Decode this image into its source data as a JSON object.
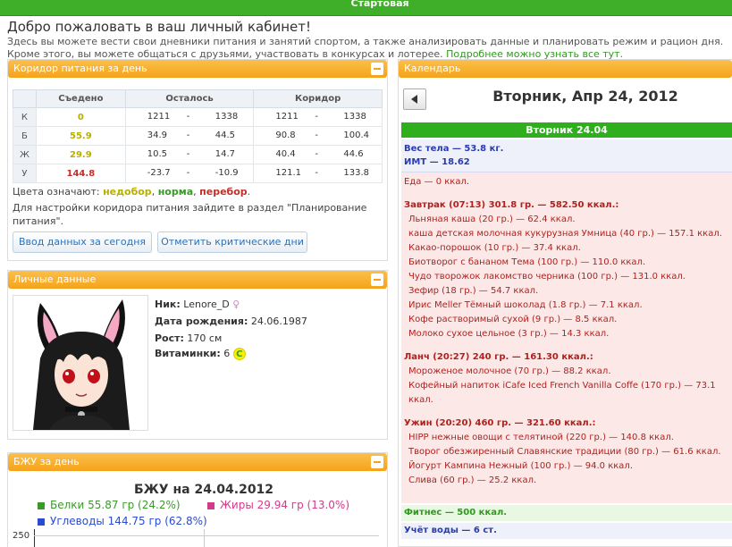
{
  "topbar": {
    "tab": "Стартовая"
  },
  "welcome": "Добро пожаловать в ваш личный кабинет!",
  "desc": {
    "line1": "Здесь вы можете вести свои дневники питания и занятий спортом, а также анализировать данные и планировать режим и рацион дня.",
    "line2": "Кроме этого, вы можете общаться с друзьями, участвовать в конкурсах и лотерее.",
    "more_link": "Подробнее можно узнать все тут."
  },
  "corridor": {
    "title": "Коридор питания за день",
    "headers": [
      "Съедено",
      "Осталось",
      "Коридор"
    ],
    "rows": [
      {
        "label": "К",
        "eaten": "0",
        "rem_min": "1211",
        "rem_max": "1338",
        "cor_min": "1211",
        "cor_max": "1338",
        "status": "under"
      },
      {
        "label": "Б",
        "eaten": "55.9",
        "rem_min": "34.9",
        "rem_max": "44.5",
        "cor_min": "90.8",
        "cor_max": "100.4",
        "status": "under"
      },
      {
        "label": "Ж",
        "eaten": "29.9",
        "rem_min": "10.5",
        "rem_max": "14.7",
        "cor_min": "40.4",
        "cor_max": "44.6",
        "status": "under"
      },
      {
        "label": "У",
        "eaten": "144.8",
        "rem_min": "-23.7",
        "rem_max": "-10.9",
        "cor_min": "121.1",
        "cor_max": "133.8",
        "status": "over"
      }
    ],
    "dash": "-",
    "legend_prefix": "Цвета означают:",
    "legend_under": "недобор",
    "legend_norm": "норма",
    "legend_over": "перебор",
    "note": "Для настройки коридора питания зайдите в раздел \"Планирование питания\".",
    "btn_today": "Ввод данных за сегодня",
    "btn_critical": "Отметить критические дни",
    "colors": {
      "under": "#b8b000",
      "norm": "#3a9a28",
      "over": "#c0302a"
    }
  },
  "personal": {
    "title": "Личные данные",
    "nick_label": "Ник:",
    "nick": "Lenore_D",
    "birth_label": "Дата рождения:",
    "birth": "24.06.1987",
    "height_label": "Рост:",
    "height": "170 см",
    "vit_label": "Витаминки:",
    "vit": "6",
    "vit_icon": "C"
  },
  "bju": {
    "title": "БЖУ за день",
    "chart_title": "БЖУ на 24.04.2012",
    "protein": "Белки 55.87 гр (24.2%)",
    "fat": "Жиры 29.94 гр (13.0%)",
    "carbs": "Углеводы 144.75 гр (62.8%)",
    "ytick": "250"
  },
  "calendar": {
    "title": "Календарь",
    "date": "Вторник, Апр 24, 2012",
    "day_band": "Вторник 24.04",
    "weight": "Вес тела — 53.8 кг.",
    "bmi": "ИМТ — 18.62",
    "food_total": "Еда — 0 ккал.",
    "breakfast": {
      "head": "Завтрак (07:13) 301.8 гр. — 582.50 ккал.:",
      "items": [
        "Льняная каша (20 гр.) — 62.4 ккал.",
        "каша детская молочная кукурузная Умница (40 гр.) — 157.1 ккал.",
        "Какао-порошок (10 гр.) — 37.4 ккал.",
        "Биотворог с бананом Тема (100 гр.) — 110.0 ккал.",
        "Чудо творожок лакомство черника (100 гр.) — 131.0 ккал.",
        "Зефир (18 гр.) — 54.7 ккал.",
        "Ирис Meller Тёмный шоколад (1.8 гр.) — 7.1 ккал.",
        "Кофе растворимый сухой (9 гр.) — 8.5 ккал.",
        "Молоко сухое цельное (3 гр.) — 14.3 ккал."
      ]
    },
    "lunch": {
      "head": "Ланч (20:27) 240 гр. — 161.30 ккал.:",
      "items": [
        "Мороженое молочное (70 гр.) — 88.2 ккал.",
        "Кофейный напиток iCafe Iced French Vanilla Coffe (170 гр.) — 73.1 ккал."
      ]
    },
    "dinner": {
      "head": "Ужин (20:20) 460 гр. — 321.60 ккал.:",
      "items": [
        "HIPP нежные овощи с телятиной (220 гр.) — 140.8 ккал.",
        "Творог обезжиренный Славянские традиции (80 гр.) — 61.6 ккал.",
        "Йогурт Кампина Нежный (100 гр.) — 94.0 ккал.",
        "Слива (60 гр.) — 25.2 ккал."
      ]
    },
    "fitness": "Фитнес — 500 ккал.",
    "water": "Учёт воды — 6 ст."
  }
}
